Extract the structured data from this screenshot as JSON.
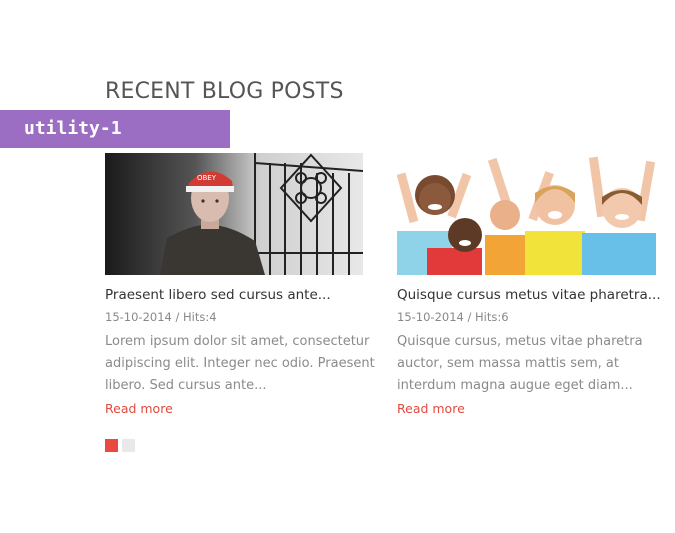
{
  "section": {
    "title": "RECENT BLOG POSTS",
    "badge": "utility-1"
  },
  "posts": [
    {
      "title": "Praesent libero sed cursus ante...",
      "date": "15-10-2014",
      "hits_label": "Hits:",
      "hits": "4",
      "excerpt": "Lorem ipsum dolor sit amet, consectetur adipiscing elit. Integer nec odio. Praesent libero. Sed cursus ante...",
      "read_more": "Read more",
      "image": "boy-with-cap-photo"
    },
    {
      "title": "Quisque cursus metus vitae pharetra...",
      "date": "15-10-2014",
      "hits_label": "Hits:",
      "hits": "6",
      "excerpt": "Quisque cursus, metus vitae pharetra auctor, sem massa mattis sem, at interdum magna augue eget diam...",
      "read_more": "Read more",
      "image": "happy-children-photo"
    }
  ],
  "pager": {
    "pages": 2,
    "active": 1
  },
  "colors": {
    "badge": "#9b6ec4",
    "link": "#e04a3f",
    "pager_active": "#e94a3f",
    "pager_inactive": "#e9e9e9"
  }
}
